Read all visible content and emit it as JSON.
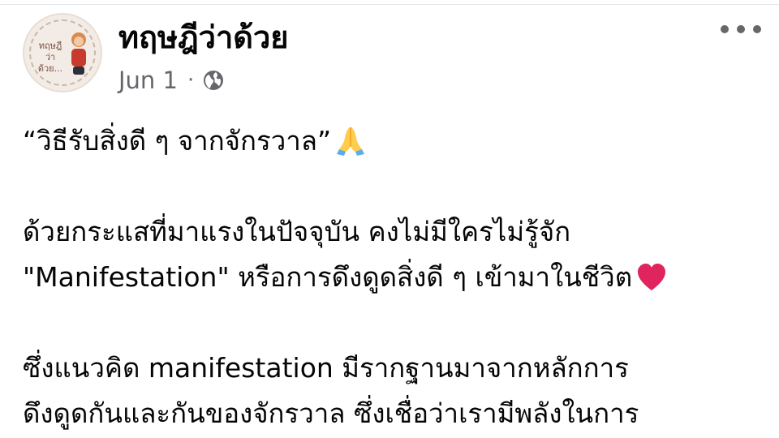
{
  "post": {
    "author_name": "ทฤษฎีว่าด้วย",
    "avatar_text": "ทฤษฎีว่าด้วย...",
    "date": "Jun 1",
    "separator": "·",
    "privacy_icon": "globe-icon",
    "more_icon": "more-horizontal-icon",
    "title_line": "“วิธีรับสิ่งดี ๆ จากจักรวาล”",
    "title_emoji": "folded-hands-emoji",
    "para1_line1": "ด้วยกระแสที่มาแรงในปัจจุบัน คงไม่มีใครไม่รู้จัก",
    "para1_line2": "\"Manifestation\" หรือการดึงดูดสิ่งดี ๆ เข้ามาในชีวิต",
    "para1_emoji": "red-heart-emoji",
    "para2_line1": "ซึ่งแนวคิด manifestation มีรากฐานมาจากหลักการ",
    "para2_line2": "ดึงดูดกันและกันของจักรวาล ซึ่งเชื่อว่าเรามีพลังในการ"
  },
  "colors": {
    "text": "#050505",
    "meta": "#65676b",
    "heart": "#e0245e",
    "hands": "#ffcc4d"
  }
}
